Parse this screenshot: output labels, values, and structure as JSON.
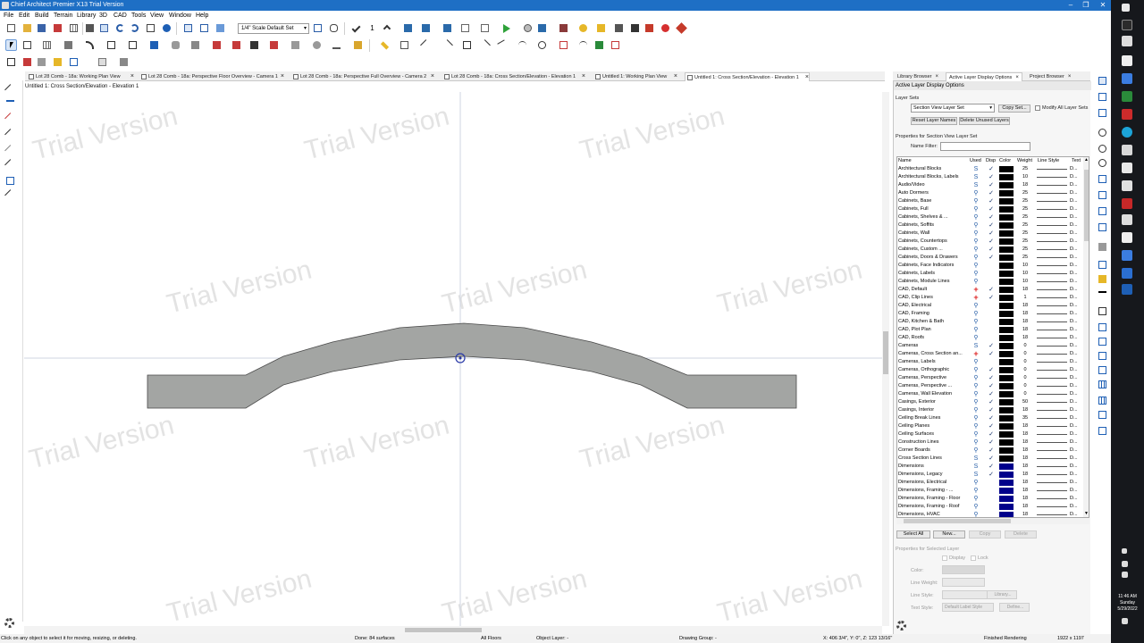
{
  "window": {
    "title": "Chief Architect Premier X13 Trial Version",
    "min_glyph": "–",
    "max_glyph": "❐",
    "close_glyph": "✕"
  },
  "menu": [
    "File",
    "Edit",
    "Build",
    "Terrain",
    "Library",
    "3D",
    "CAD",
    "Tools",
    "View",
    "Window",
    "Help"
  ],
  "toolbar": {
    "scale_value": "1/4\" Scale Default Set",
    "number_value": "1"
  },
  "doc_tabs": [
    {
      "label": "Lot 28 Comb - 18a: Working Plan View"
    },
    {
      "label": "Lot 28 Comb - 18a: Perspective Floor Overview - Camera 1"
    },
    {
      "label": "Lot 28 Comb - 18a: Perspective Full Overview - Camera 2"
    },
    {
      "label": "Lot 28 Comb - 18a: Cross Section/Elevation - Elevation 1"
    },
    {
      "label": "Untitled 1: Working Plan View"
    },
    {
      "label": "Untitled 1: Cross Section/Elevation - Elevation 1"
    }
  ],
  "tab_close": "×",
  "view_title": "Untitled 1: Cross Section/Elevation - Elevation 1",
  "watermark": "Trial Version",
  "panel_tabs": [
    {
      "label": "Library Browser"
    },
    {
      "label": "Active Layer Display Options"
    },
    {
      "label": "Project Browser"
    }
  ],
  "panel": {
    "title": "Active Layer Display Options",
    "layer_sets_label": "Layer Sets",
    "layer_set_value": "Section View Layer Set",
    "copy_set": "Copy Set...",
    "modify_all": "Modify All Layer Sets",
    "reset_names": "Reset Layer Names",
    "delete_unused": "Delete Unused Layers",
    "properties_for": "Properties for Section View Layer Set",
    "name_filter": "Name Filter:",
    "columns": {
      "name": "Name",
      "used": "Used",
      "disp": "Disp",
      "color": "Color",
      "weight": "Weight",
      "line_style": "Line Style",
      "text": "Text"
    },
    "select_all": "Select All",
    "new": "New...",
    "copy": "Copy",
    "delete": "Delete",
    "selected_props": "Properties for Selected Layer",
    "display": "Display",
    "lock": "Lock",
    "color_lbl": "Color:",
    "line_weight": "Line Weight:",
    "line_style": "Line Style:",
    "library_btn": "Library...",
    "text_style": "Text Style:",
    "text_style_value": "Default Label Style",
    "define_btn": "Define..."
  },
  "layers": [
    {
      "name": "Architectural Blocks",
      "used": "S",
      "disp": true,
      "color": "#000000",
      "weight": "25",
      "text": "D..."
    },
    {
      "name": "Architectural Blocks, Labels",
      "used": "S",
      "disp": true,
      "color": "#000000",
      "weight": "10",
      "text": "D..."
    },
    {
      "name": "Audio/Video",
      "used": "S",
      "disp": true,
      "color": "#000000",
      "weight": "18",
      "text": "D..."
    },
    {
      "name": "Auto Dormers",
      "used": "o",
      "disp": true,
      "color": "#000000",
      "weight": "25",
      "text": "D..."
    },
    {
      "name": "Cabinets,  Base",
      "used": "o",
      "disp": true,
      "color": "#000000",
      "weight": "25",
      "text": "D..."
    },
    {
      "name": "Cabinets,  Full",
      "used": "o",
      "disp": true,
      "color": "#000000",
      "weight": "25",
      "text": "D..."
    },
    {
      "name": "Cabinets,  Shelves & ...",
      "used": "o",
      "disp": true,
      "color": "#000000",
      "weight": "25",
      "text": "D..."
    },
    {
      "name": "Cabinets,  Soffits",
      "used": "o",
      "disp": true,
      "color": "#000000",
      "weight": "25",
      "text": "D..."
    },
    {
      "name": "Cabinets,  Wall",
      "used": "o",
      "disp": true,
      "color": "#000000",
      "weight": "25",
      "text": "D..."
    },
    {
      "name": "Cabinets, Countertops",
      "used": "o",
      "disp": true,
      "color": "#000000",
      "weight": "25",
      "text": "D..."
    },
    {
      "name": "Cabinets, Custom ...",
      "used": "o",
      "disp": true,
      "color": "#000000",
      "weight": "25",
      "text": "D..."
    },
    {
      "name": "Cabinets, Doors & Drawers",
      "used": "o",
      "disp": true,
      "color": "#000000",
      "weight": "25",
      "text": "D..."
    },
    {
      "name": "Cabinets, Face Indicators",
      "used": "o",
      "disp": false,
      "color": "#000000",
      "weight": "10",
      "text": "D..."
    },
    {
      "name": "Cabinets, Labels",
      "used": "o",
      "disp": false,
      "color": "#000000",
      "weight": "10",
      "text": "D..."
    },
    {
      "name": "Cabinets, Module Lines",
      "used": "o",
      "disp": false,
      "color": "#000000",
      "weight": "10",
      "text": "D..."
    },
    {
      "name": "CAD,  Default",
      "used": "+",
      "disp": true,
      "color": "#000000",
      "weight": "18",
      "text": "D..."
    },
    {
      "name": "CAD, Clip Lines",
      "used": "+",
      "disp": true,
      "color": "#000000",
      "weight": "1",
      "text": "D..."
    },
    {
      "name": "CAD, Electrical",
      "used": "o",
      "disp": false,
      "color": "#000000",
      "weight": "18",
      "text": "D..."
    },
    {
      "name": "CAD, Framing",
      "used": "o",
      "disp": false,
      "color": "#000000",
      "weight": "18",
      "text": "D..."
    },
    {
      "name": "CAD, Kitchen & Bath",
      "used": "o",
      "disp": false,
      "color": "#000000",
      "weight": "18",
      "text": "D..."
    },
    {
      "name": "CAD, Plot Plan",
      "used": "o",
      "disp": false,
      "color": "#000000",
      "weight": "18",
      "text": "D..."
    },
    {
      "name": "CAD, Roofs",
      "used": "o",
      "disp": false,
      "color": "#000000",
      "weight": "18",
      "text": "D..."
    },
    {
      "name": "Cameras",
      "used": "S",
      "disp": true,
      "color": "#000000",
      "weight": "0",
      "text": "D..."
    },
    {
      "name": "Cameras, Cross Section an...",
      "used": "+",
      "disp": true,
      "color": "#000000",
      "weight": "0",
      "text": "D..."
    },
    {
      "name": "Cameras, Labels",
      "used": "o",
      "disp": false,
      "color": "#000000",
      "weight": "0",
      "text": "D..."
    },
    {
      "name": "Cameras, Orthographic",
      "used": "o",
      "disp": true,
      "color": "#000000",
      "weight": "0",
      "text": "D..."
    },
    {
      "name": "Cameras, Perspective",
      "used": "o",
      "disp": true,
      "color": "#000000",
      "weight": "0",
      "text": "D..."
    },
    {
      "name": "Cameras, Perspective ...",
      "used": "o",
      "disp": true,
      "color": "#000000",
      "weight": "0",
      "text": "D..."
    },
    {
      "name": "Cameras, Wall Elevation",
      "used": "o",
      "disp": true,
      "color": "#000000",
      "weight": "0",
      "text": "D..."
    },
    {
      "name": "Casings, Exterior",
      "used": "o",
      "disp": true,
      "color": "#000000",
      "weight": "50",
      "text": "D..."
    },
    {
      "name": "Casings, Interior",
      "used": "o",
      "disp": true,
      "color": "#000000",
      "weight": "18",
      "text": "D..."
    },
    {
      "name": "Ceiling Break Lines",
      "used": "o",
      "disp": true,
      "color": "#000000",
      "weight": "35",
      "text": "D..."
    },
    {
      "name": "Ceiling Planes",
      "used": "o",
      "disp": true,
      "color": "#000000",
      "weight": "18",
      "text": "D..."
    },
    {
      "name": "Ceiling Surfaces",
      "used": "o",
      "disp": true,
      "color": "#000000",
      "weight": "18",
      "text": "D..."
    },
    {
      "name": "Construction Lines",
      "used": "o",
      "disp": true,
      "color": "#000000",
      "weight": "18",
      "text": "D..."
    },
    {
      "name": "Corner Boards",
      "used": "o",
      "disp": true,
      "color": "#000000",
      "weight": "18",
      "text": "D..."
    },
    {
      "name": "Cross Section Lines",
      "used": "S",
      "disp": true,
      "color": "#000000",
      "weight": "18",
      "text": "D..."
    },
    {
      "name": "Dimensions",
      "used": "S",
      "disp": true,
      "color": "#00008b",
      "weight": "18",
      "text": "D..."
    },
    {
      "name": "Dimensions,  Legacy",
      "used": "S",
      "disp": true,
      "color": "#00008b",
      "weight": "18",
      "text": "D..."
    },
    {
      "name": "Dimensions, Electrical",
      "used": "o",
      "disp": false,
      "color": "#00008b",
      "weight": "18",
      "text": "D..."
    },
    {
      "name": "Dimensions, Framing - ...",
      "used": "o",
      "disp": false,
      "color": "#00008b",
      "weight": "18",
      "text": "D..."
    },
    {
      "name": "Dimensions, Framing - Floor",
      "used": "o",
      "disp": false,
      "color": "#00008b",
      "weight": "18",
      "text": "D..."
    },
    {
      "name": "Dimensions, Framing - Roof",
      "used": "o",
      "disp": false,
      "color": "#00008b",
      "weight": "18",
      "text": "D..."
    },
    {
      "name": "Dimensions, HVAC",
      "used": "o",
      "disp": false,
      "color": "#00008b",
      "weight": "18",
      "text": "D..."
    }
  ],
  "status": {
    "hint": "Click on any object to select it for moving, resizing, or deleting.",
    "done": "Done:  84 surfaces",
    "floors": "All Floors",
    "object_layer": "Object Layer: -",
    "drawing_group": "Drawing Group: -",
    "coords": "X: 406 3/4\",  Y: 0\",  Z: 123 13/16\"",
    "rendering": "Finished Rendering",
    "resolution": "1922 x 1197"
  },
  "clock": {
    "time": "11:46 AM",
    "day": "Sunday",
    "date": "5/29/2022"
  },
  "colors": {
    "titlebar": "#1e6fc5",
    "shape_fill": "#a3a5a3",
    "taskbar": "#16181c"
  }
}
